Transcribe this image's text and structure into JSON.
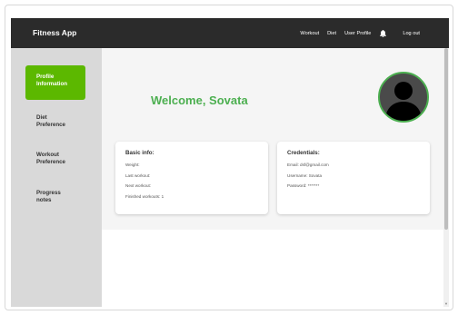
{
  "header": {
    "brand": "Fitness App",
    "nav": [
      "Workout",
      "Diet",
      "User Profile"
    ],
    "logout": "Log out"
  },
  "sidebar": {
    "items": [
      {
        "label": "Profile Information",
        "active": true
      },
      {
        "label": "Diet Preference",
        "active": false
      },
      {
        "label": "Workout Preference",
        "active": false
      },
      {
        "label": "Progress notes",
        "active": false
      }
    ]
  },
  "main": {
    "welcome": "Welcome, Sovata",
    "basic_info": {
      "title": "Basic info:",
      "lines": [
        "Weight:",
        "Last workout:",
        "Next workout:",
        "Finished workouts: 1"
      ]
    },
    "credentials": {
      "title": "Credentials:",
      "lines": [
        "Email: dsf@gmail.com",
        "Username: Sovata",
        "Password: *******"
      ]
    }
  },
  "colors": {
    "topbar": "#2b2b2b",
    "accent": "#5cb800",
    "welcome": "#4caf50",
    "sidebar": "#d9d9d9"
  },
  "icons": {
    "notification": "bell-icon",
    "avatar": "user-silhouette-icon"
  }
}
